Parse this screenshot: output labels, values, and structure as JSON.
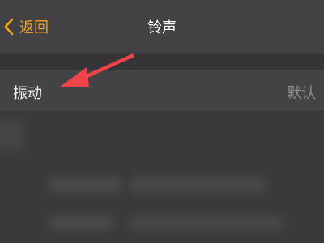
{
  "nav": {
    "back_label": "返回",
    "title": "铃声"
  },
  "row": {
    "label": "振动",
    "value": "默认"
  },
  "colors": {
    "accent": "#f0a01c",
    "arrow": "#f0434a"
  },
  "icons": {
    "back": "chevron-left-icon"
  }
}
